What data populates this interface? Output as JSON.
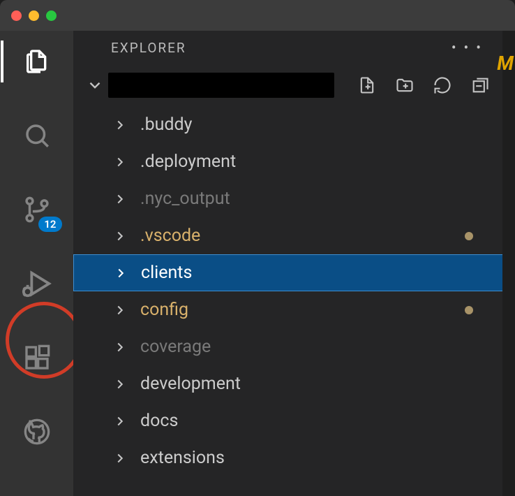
{
  "panel": {
    "title": "EXPLORER"
  },
  "scm_badge": "12",
  "tree": {
    "items": [
      {
        "label": ".buddy",
        "style": "default",
        "modified": false
      },
      {
        "label": ".deployment",
        "style": "default",
        "modified": false
      },
      {
        "label": ".nyc_output",
        "style": "dim",
        "modified": false
      },
      {
        "label": ".vscode",
        "style": "mod",
        "modified": true
      },
      {
        "label": "clients",
        "style": "selected",
        "modified": false
      },
      {
        "label": "config",
        "style": "mod",
        "modified": true
      },
      {
        "label": "coverage",
        "style": "dim",
        "modified": false
      },
      {
        "label": "development",
        "style": "default",
        "modified": false
      },
      {
        "label": "docs",
        "style": "default",
        "modified": false
      },
      {
        "label": "extensions",
        "style": "default",
        "modified": false
      }
    ]
  }
}
